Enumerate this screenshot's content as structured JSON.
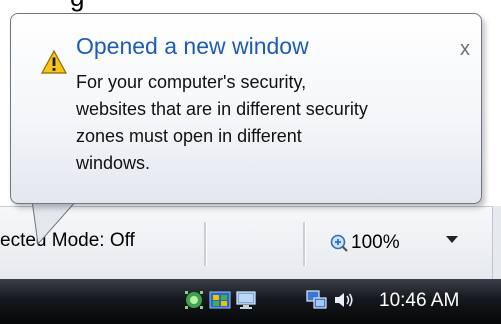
{
  "top_fragment": "g",
  "notification": {
    "title": "Opened a new window",
    "body_lines": [
      "For your computer's security,",
      "websites that are in different security",
      "zones must open in different",
      "windows."
    ],
    "close_label": "x",
    "icon": "warning-icon"
  },
  "status_bar": {
    "protected_mode_text": "ected Mode: Off",
    "zoom_label": "100%",
    "zoom_icon": "zoom-icon",
    "zoom_dropdown_icon": "dropdown-arrow-icon"
  },
  "taskbar": {
    "tray_icons": [
      "network-activity-icon",
      "network-status-icon",
      "display-icon",
      "network-connection-icon",
      "volume-icon"
    ],
    "clock": "10:46 AM"
  },
  "colors": {
    "title_blue": "#1e5bb8",
    "warning_yellow": "#f5c518",
    "taskbar_black": "#0a0b0d"
  }
}
